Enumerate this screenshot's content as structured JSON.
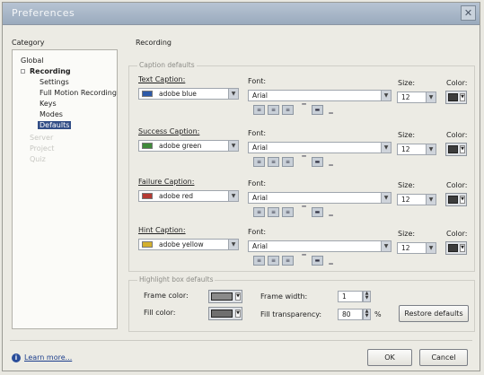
{
  "window": {
    "title": "Preferences",
    "close_glyph": "✕"
  },
  "category": {
    "label": "Category",
    "items": [
      {
        "label": "Global"
      },
      {
        "label": "Recording"
      },
      {
        "label": "Settings"
      },
      {
        "label": "Full Motion Recording"
      },
      {
        "label": "Keys"
      },
      {
        "label": "Modes"
      },
      {
        "label": "Defaults"
      },
      {
        "label": "Server"
      },
      {
        "label": "Project"
      },
      {
        "label": "Quiz"
      }
    ]
  },
  "panel": {
    "title": "Recording"
  },
  "caption_defaults": {
    "title": "Caption defaults",
    "font_label": "Font:",
    "size_label": "Size:",
    "color_label": "Color:",
    "rows": [
      {
        "label": "Text Caption:",
        "style": "adobe blue",
        "style_color": "#2d5aa8",
        "font": "Arial",
        "size": "12",
        "chip_color": "#3c3c3c"
      },
      {
        "label": "Success Caption:",
        "style": "adobe green",
        "style_color": "#3f8a3a",
        "font": "Arial",
        "size": "12",
        "chip_color": "#3c3c3c"
      },
      {
        "label": "Failure Caption:",
        "style": "adobe red",
        "style_color": "#b53a33",
        "font": "Arial",
        "size": "12",
        "chip_color": "#3c3c3c"
      },
      {
        "label": "Hint Caption:",
        "style": "adobe yellow",
        "style_color": "#d4b02e",
        "font": "Arial",
        "size": "12",
        "chip_color": "#3c3c3c"
      }
    ],
    "format_icons": [
      "align-left-icon",
      "align-center-icon",
      "align-right-icon",
      "valign-top-icon",
      "valign-middle-icon",
      "valign-bottom-icon"
    ]
  },
  "highlight_defaults": {
    "title": "Highlight box defaults",
    "frame_color_label": "Frame color:",
    "frame_color": "#8a8a8a",
    "fill_color_label": "Fill color:",
    "fill_color": "#6f6f6f",
    "frame_width_label": "Frame width:",
    "frame_width": "1",
    "fill_transparency_label": "Fill transparency:",
    "fill_transparency": "80",
    "percent": "%",
    "restore_label": "Restore defaults"
  },
  "footer": {
    "learn_more": "Learn more...",
    "info_glyph": "i",
    "ok": "OK",
    "cancel": "Cancel"
  }
}
